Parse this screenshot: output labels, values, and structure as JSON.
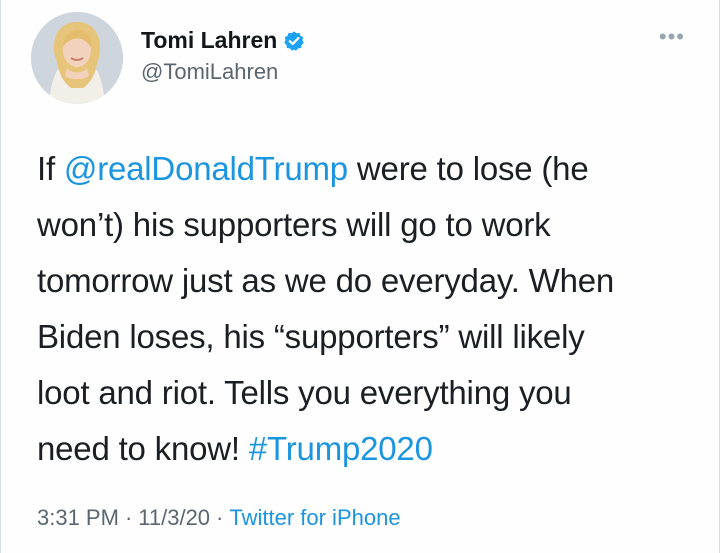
{
  "tweet": {
    "author": {
      "name": "Tomi Lahren",
      "handle": "@TomiLahren",
      "avatar_icon": "profile-photo",
      "verified_icon": "verified-badge-icon",
      "verified_color": "#1da1f2"
    },
    "more_label": "•••",
    "text": {
      "line1_pre": "If ",
      "mention": "@realDonaldTrump",
      "line1_post": " were to lose (he",
      "line2": "won’t) his supporters will go to work",
      "line3": "tomorrow just as we do everyday. When",
      "line4": "Biden loses, his “supporters” will likely",
      "line5": "loot and riot. Tells you everything you",
      "line6_pre": "need to know! ",
      "hashtag": "#Trump2020"
    },
    "meta": {
      "time": "3:31 PM",
      "separator": "·",
      "date": "11/3/20",
      "source": "Twitter for iPhone"
    },
    "colors": {
      "link": "#1b95e0",
      "text": "#1b1f23",
      "muted": "#5b6670"
    }
  }
}
